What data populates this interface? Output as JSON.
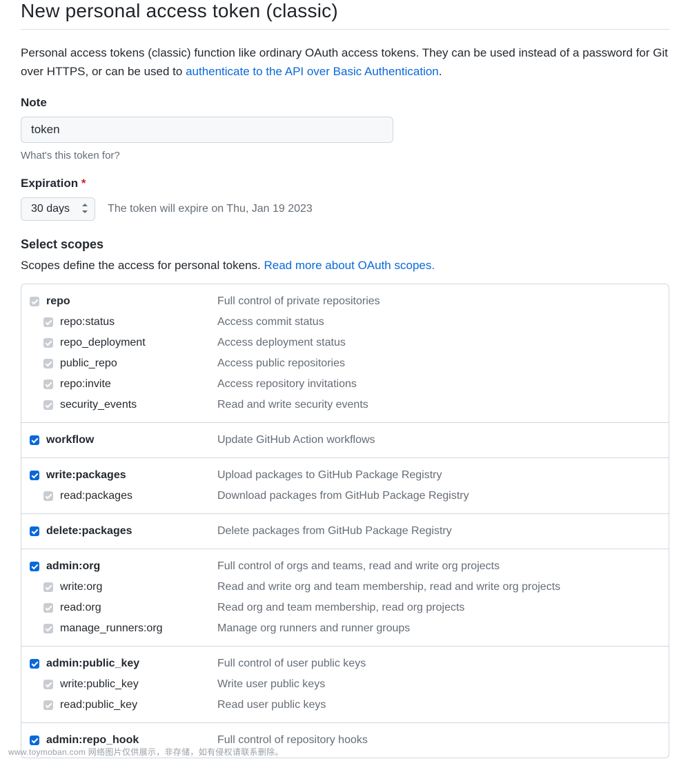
{
  "page_title": "New personal access token (classic)",
  "intro_text": "Personal access tokens (classic) function like ordinary OAuth access tokens. They can be used instead of a password for Git over HTTPS, or can be used to ",
  "intro_link": "authenticate to the API over Basic Authentication",
  "intro_dot": ".",
  "note": {
    "label": "Note",
    "value": "token",
    "hint": "What's this token for?"
  },
  "expiration": {
    "label": "Expiration",
    "required_mark": "*",
    "selected": "30 days",
    "message": "The token will expire on Thu, Jan 19 2023"
  },
  "scopes_section": {
    "title": "Select scopes",
    "intro_text": "Scopes define the access for personal tokens. ",
    "intro_link": "Read more about OAuth scopes."
  },
  "scope_groups": [
    {
      "parent": {
        "name": "repo",
        "desc": "Full control of private repositories",
        "checked": true,
        "dim": true
      },
      "children": [
        {
          "name": "repo:status",
          "desc": "Access commit status",
          "checked": true,
          "dim": true
        },
        {
          "name": "repo_deployment",
          "desc": "Access deployment status",
          "checked": true,
          "dim": true
        },
        {
          "name": "public_repo",
          "desc": "Access public repositories",
          "checked": true,
          "dim": true
        },
        {
          "name": "repo:invite",
          "desc": "Access repository invitations",
          "checked": true,
          "dim": true
        },
        {
          "name": "security_events",
          "desc": "Read and write security events",
          "checked": true,
          "dim": true
        }
      ]
    },
    {
      "parent": {
        "name": "workflow",
        "desc": "Update GitHub Action workflows",
        "checked": true,
        "dim": false
      },
      "children": []
    },
    {
      "parent": {
        "name": "write:packages",
        "desc": "Upload packages to GitHub Package Registry",
        "checked": true,
        "dim": false
      },
      "children": [
        {
          "name": "read:packages",
          "desc": "Download packages from GitHub Package Registry",
          "checked": true,
          "dim": true
        }
      ]
    },
    {
      "parent": {
        "name": "delete:packages",
        "desc": "Delete packages from GitHub Package Registry",
        "checked": true,
        "dim": false
      },
      "children": []
    },
    {
      "parent": {
        "name": "admin:org",
        "desc": "Full control of orgs and teams, read and write org projects",
        "checked": true,
        "dim": false
      },
      "children": [
        {
          "name": "write:org",
          "desc": "Read and write org and team membership, read and write org projects",
          "checked": true,
          "dim": true
        },
        {
          "name": "read:org",
          "desc": "Read org and team membership, read org projects",
          "checked": true,
          "dim": true
        },
        {
          "name": "manage_runners:org",
          "desc": "Manage org runners and runner groups",
          "checked": true,
          "dim": true
        }
      ]
    },
    {
      "parent": {
        "name": "admin:public_key",
        "desc": "Full control of user public keys",
        "checked": true,
        "dim": false
      },
      "children": [
        {
          "name": "write:public_key",
          "desc": "Write user public keys",
          "checked": true,
          "dim": true
        },
        {
          "name": "read:public_key",
          "desc": "Read user public keys",
          "checked": true,
          "dim": true
        }
      ]
    },
    {
      "parent": {
        "name": "admin:repo_hook",
        "desc": "Full control of repository hooks",
        "checked": true,
        "dim": false
      },
      "children": []
    }
  ],
  "watermark": "www.toymoban.com 网络图片仅供展示，非存储，如有侵权请联系删除。"
}
